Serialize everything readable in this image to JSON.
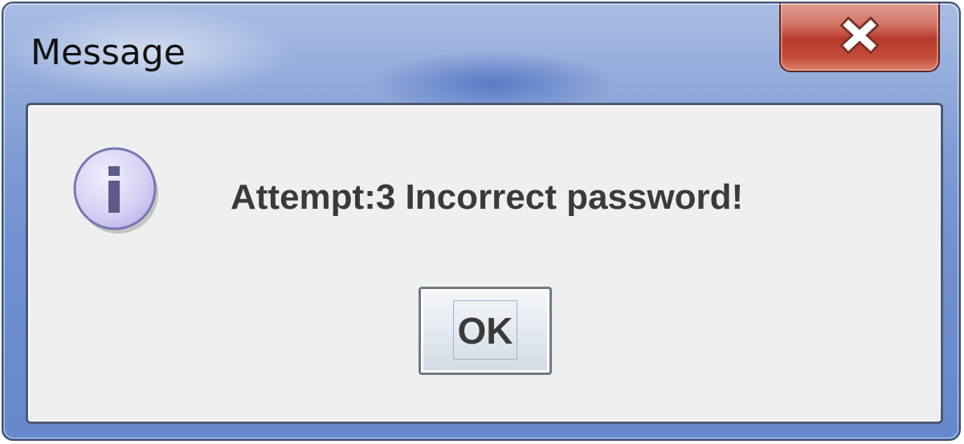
{
  "window": {
    "title": "Message",
    "close_icon": "close-icon"
  },
  "dialog": {
    "icon": "info-icon",
    "message": "Attempt:3 Incorrect password!",
    "ok_label": "OK"
  },
  "colors": {
    "title_bar": "#7f9bd4",
    "close_button": "#c24a38",
    "client_background": "#efefef",
    "info_icon_fill": "#d9d6f5",
    "info_icon_glyph": "#5e5a8a"
  }
}
